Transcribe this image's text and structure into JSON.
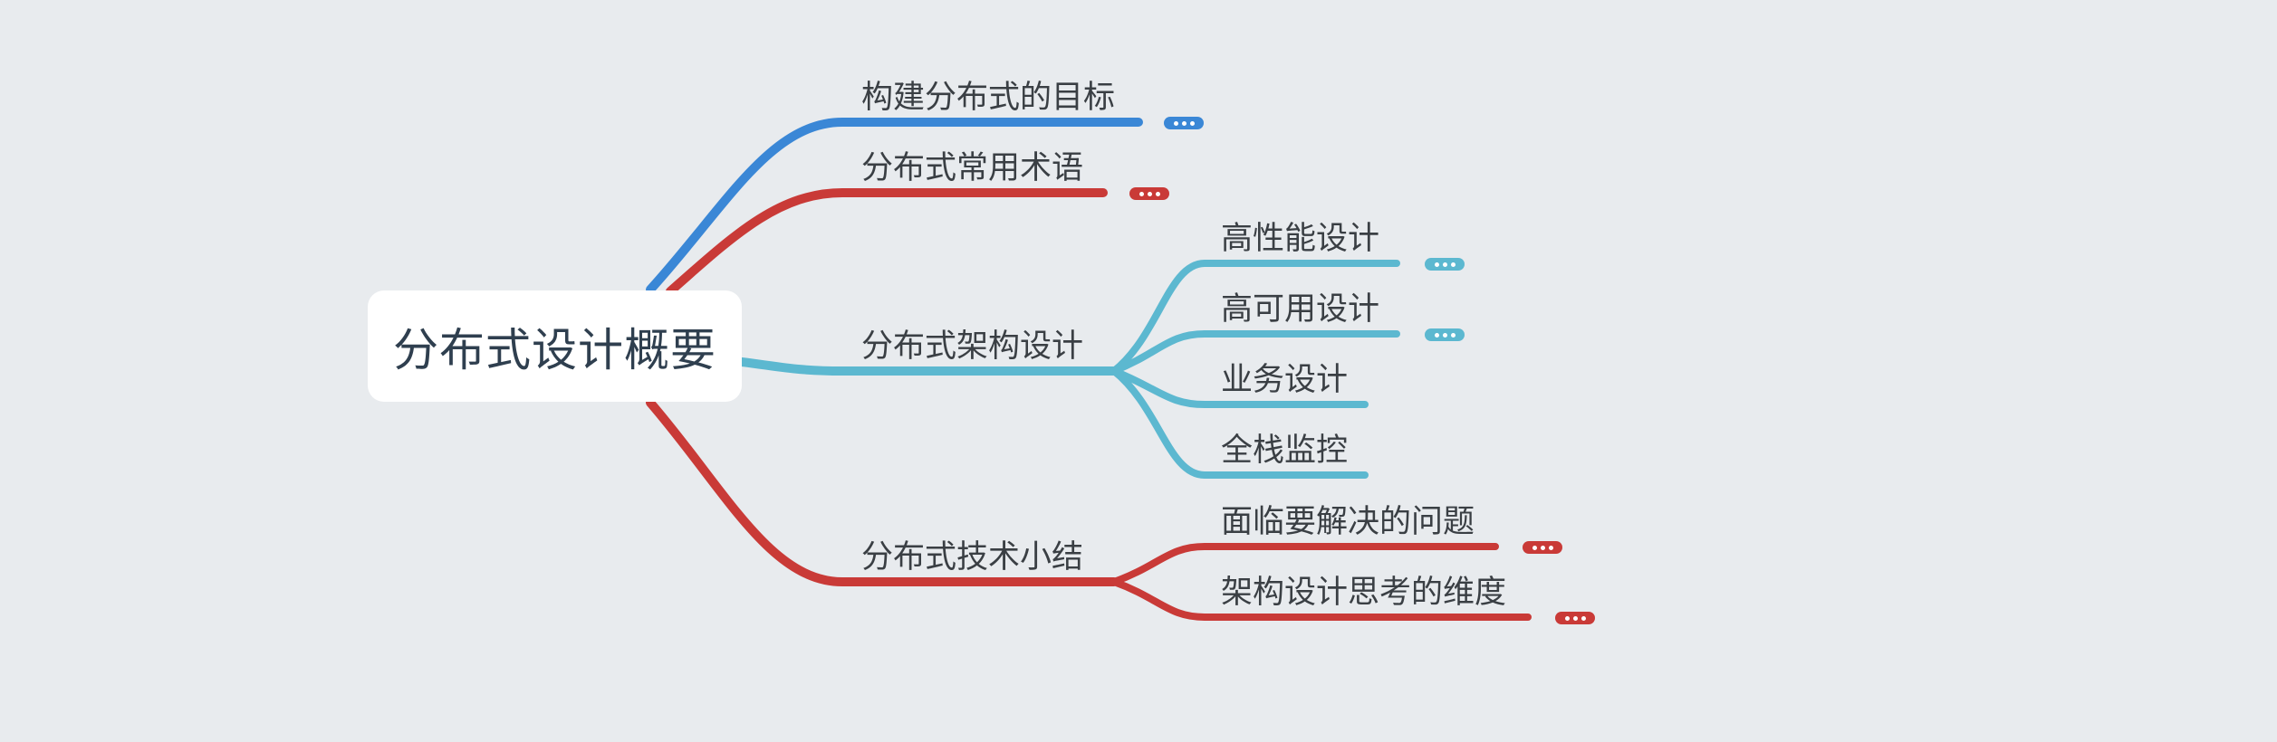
{
  "colors": {
    "background": "#e8ebee",
    "blue": "#3a87d6",
    "red": "#c93a37",
    "teal": "#5cb8d0"
  },
  "root": {
    "label": "分布式设计概要"
  },
  "branches": [
    {
      "id": "goal",
      "label": "构建分布式的目标",
      "color": "#3a87d6",
      "collapsed": true
    },
    {
      "id": "terms",
      "label": "分布式常用术语",
      "color": "#c93a37",
      "collapsed": true
    },
    {
      "id": "arch",
      "label": "分布式架构设计",
      "color": "#5cb8d0",
      "collapsed": false,
      "children": [
        {
          "id": "perf",
          "label": "高性能设计",
          "collapsed": true
        },
        {
          "id": "avail",
          "label": "高可用设计",
          "collapsed": true
        },
        {
          "id": "biz",
          "label": "业务设计",
          "collapsed": false
        },
        {
          "id": "monitor",
          "label": "全栈监控",
          "collapsed": false
        }
      ]
    },
    {
      "id": "summary",
      "label": "分布式技术小结",
      "color": "#c93a37",
      "collapsed": false,
      "children": [
        {
          "id": "problems",
          "label": "面临要解决的问题",
          "collapsed": true
        },
        {
          "id": "dimensions",
          "label": "架构设计思考的维度",
          "collapsed": true
        }
      ]
    }
  ]
}
